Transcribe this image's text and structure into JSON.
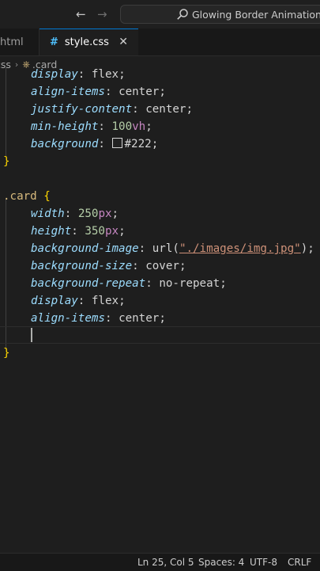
{
  "window": {
    "search_text": "Glowing Border Animation"
  },
  "tabs": [
    {
      "label": "html"
    },
    {
      "label": "style.css"
    }
  ],
  "breadcrumb": {
    "file": "css",
    "symbol": ".card"
  },
  "code": {
    "l1_prop": "display",
    "l1_val": "flex",
    "l2_prop": "align-items",
    "l2_val": "center",
    "l3_prop": "justify-content",
    "l3_val": "center",
    "l4_prop": "min-height",
    "l4_num": "100",
    "l4_unit": "vh",
    "l5_prop": "background",
    "l5_val": "#222",
    "l6_brace": "}",
    "l8_selector": ".card",
    "l8_brace": "{",
    "l9_prop": "width",
    "l9_num": "250",
    "l9_unit": "px",
    "l10_prop": "height",
    "l10_num": "350",
    "l10_unit": "px",
    "l11_prop": "background-image",
    "l11_fn": "url",
    "l11_str": "\"./images/img.jpg\"",
    "l12_prop": "background-size",
    "l12_val": "cover",
    "l13_prop": "background-repeat",
    "l13_val": "no-repeat",
    "l14_prop": "display",
    "l14_val": "flex",
    "l15_prop": "align-items",
    "l15_val": "center",
    "l17_brace": "}"
  },
  "status": {
    "position": "Ln 25, Col 5",
    "spaces": "Spaces: 4",
    "encoding": "UTF-8",
    "eol": "CRLF"
  },
  "colors": {
    "accent": "#0078d4",
    "background": "#1e1e1e"
  }
}
